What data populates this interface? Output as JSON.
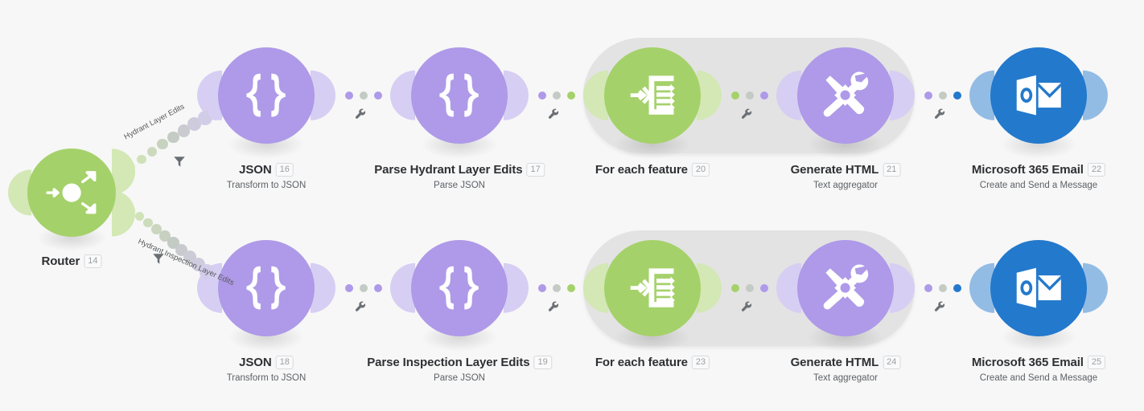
{
  "canvas": {
    "background": "#f7f7f7",
    "colors": {
      "green": "#a5d16a",
      "green_light": "#d3e8b5",
      "purple": "#ae9ae8",
      "purple_light": "#d7cef3",
      "blue": "#2379cc",
      "blue_light": "#93bce5",
      "group_gray": "#e3e3e3",
      "dot_gray": "#c4cac4",
      "title": "#2e3033",
      "subtitle": "#5d6166",
      "badge": "#9aa0a6"
    }
  },
  "router": {
    "title": "Router",
    "number": "14",
    "icon": "router-split-icon",
    "color": "#a5d16a"
  },
  "routes": [
    {
      "label": "Hydrant Layer Edits",
      "filter_icon": "filter-funnel-icon"
    },
    {
      "label": "Hydrant Inspection Layer Edits",
      "filter_icon": "filter-funnel-icon"
    }
  ],
  "rows": [
    {
      "id": "hydrant-layer-row",
      "modules": [
        {
          "title": "JSON",
          "number": "16",
          "subtitle": "Transform to JSON",
          "icon": "json-braces-icon",
          "color": "purple"
        },
        {
          "title": "Parse Hydrant Layer Edits",
          "number": "17",
          "subtitle": "Parse JSON",
          "icon": "json-braces-icon",
          "color": "purple"
        },
        {
          "title": "For each feature",
          "number": "20",
          "subtitle": "",
          "icon": "iterator-icon",
          "color": "green"
        },
        {
          "title": "Generate HTML",
          "number": "21",
          "subtitle": "Text aggregator",
          "icon": "tools-gear-icon",
          "color": "purple"
        },
        {
          "title": "Microsoft 365 Email",
          "number": "22",
          "subtitle": "Create and Send a Message",
          "icon": "outlook-icon",
          "color": "blue"
        }
      ]
    },
    {
      "id": "inspection-layer-row",
      "modules": [
        {
          "title": "JSON",
          "number": "18",
          "subtitle": "Transform to JSON",
          "icon": "json-braces-icon",
          "color": "purple"
        },
        {
          "title": "Parse Inspection Layer Edits",
          "number": "19",
          "subtitle": "Parse JSON",
          "icon": "json-braces-icon",
          "color": "purple"
        },
        {
          "title": "For each feature",
          "number": "23",
          "subtitle": "",
          "icon": "iterator-icon",
          "color": "green"
        },
        {
          "title": "Generate HTML",
          "number": "24",
          "subtitle": "Text aggregator",
          "icon": "tools-gear-icon",
          "color": "purple"
        },
        {
          "title": "Microsoft 365 Email",
          "number": "25",
          "subtitle": "Create and Send a Message",
          "icon": "outlook-icon",
          "color": "blue"
        }
      ]
    }
  ]
}
